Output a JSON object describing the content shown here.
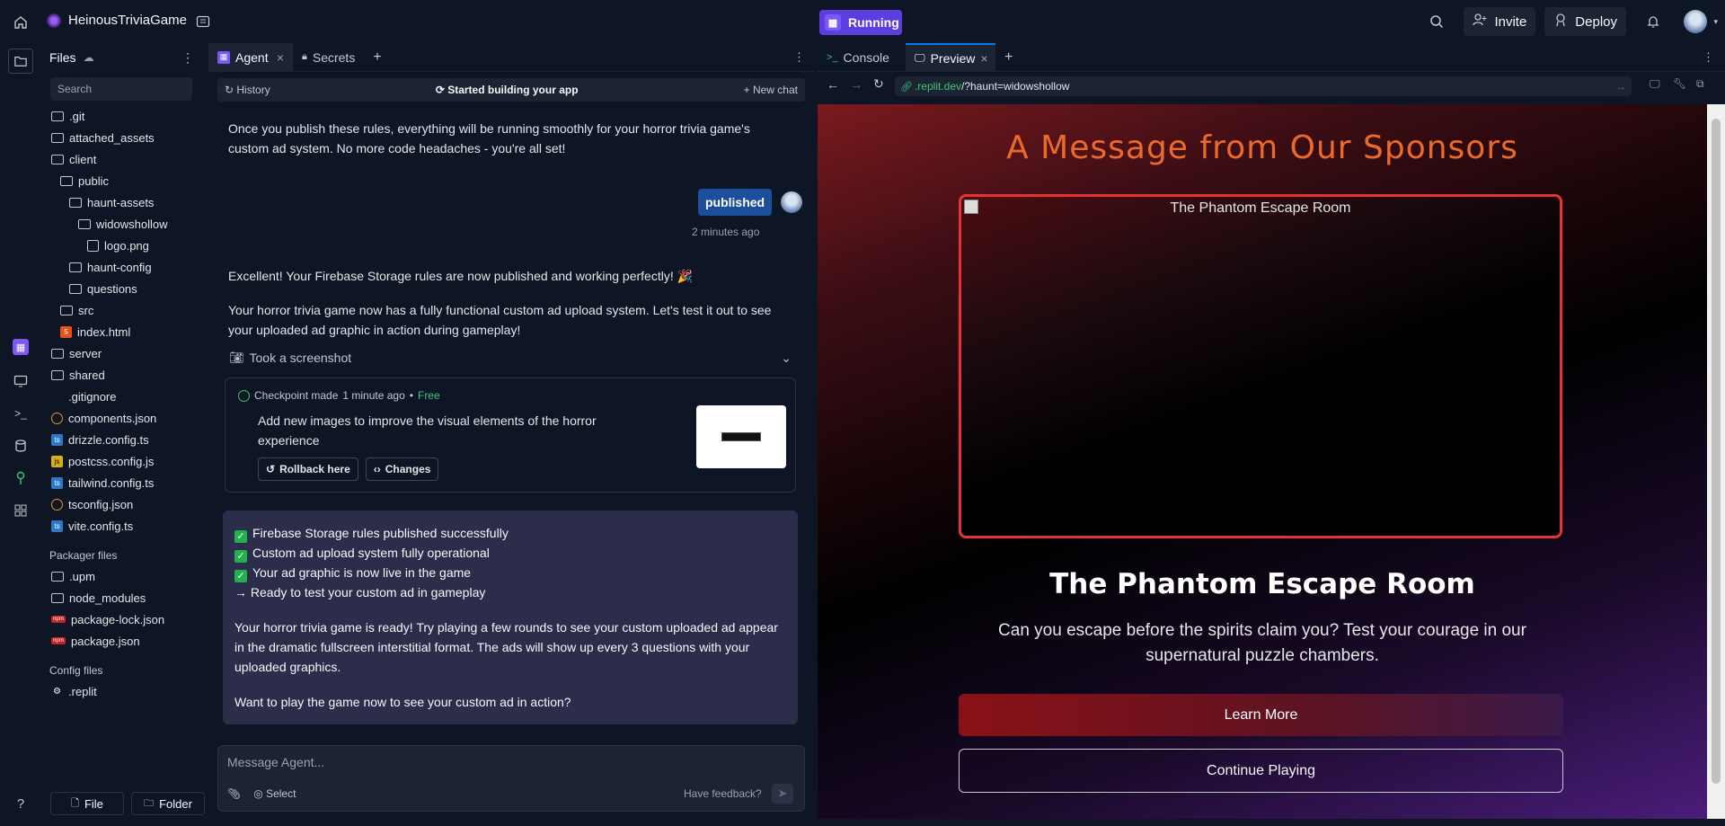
{
  "topbar": {
    "repl_name": "HeinousTriviaGame",
    "run_label": "Running",
    "invite_label": "Invite",
    "deploy_label": "Deploy"
  },
  "files": {
    "title": "Files",
    "search_placeholder": "Search",
    "tree": [
      {
        "name": ".git",
        "type": "folder",
        "depth": 0
      },
      {
        "name": "attached_assets",
        "type": "folder",
        "depth": 0
      },
      {
        "name": "client",
        "type": "folder",
        "depth": 0
      },
      {
        "name": "public",
        "type": "folder",
        "depth": 1
      },
      {
        "name": "haunt-assets",
        "type": "folder",
        "depth": 2
      },
      {
        "name": "widowshollow",
        "type": "folder",
        "depth": 3
      },
      {
        "name": "logo.png",
        "type": "image",
        "depth": 4
      },
      {
        "name": "haunt-config",
        "type": "folder",
        "depth": 2
      },
      {
        "name": "questions",
        "type": "folder",
        "depth": 2
      },
      {
        "name": "src",
        "type": "folder",
        "depth": 1
      },
      {
        "name": "index.html",
        "type": "html",
        "depth": 1
      },
      {
        "name": "server",
        "type": "folder",
        "depth": 0
      },
      {
        "name": "shared",
        "type": "folder",
        "depth": 0
      },
      {
        "name": ".gitignore",
        "type": "plain",
        "depth": 0
      },
      {
        "name": "components.json",
        "type": "json",
        "depth": 0
      },
      {
        "name": "drizzle.config.ts",
        "type": "ts",
        "depth": 0
      },
      {
        "name": "postcss.config.js",
        "type": "js",
        "depth": 0
      },
      {
        "name": "tailwind.config.ts",
        "type": "ts",
        "depth": 0
      },
      {
        "name": "tsconfig.json",
        "type": "json",
        "depth": 0
      },
      {
        "name": "vite.config.ts",
        "type": "ts",
        "depth": 0
      }
    ],
    "packager_label": "Packager files",
    "packager": [
      {
        "name": ".upm",
        "type": "folder"
      },
      {
        "name": "node_modules",
        "type": "folder"
      },
      {
        "name": "package-lock.json",
        "type": "npm"
      },
      {
        "name": "package.json",
        "type": "npm"
      }
    ],
    "config_label": "Config files",
    "config": [
      {
        "name": ".replit",
        "type": "replit"
      }
    ],
    "new_file_label": "File",
    "new_folder_label": "Folder"
  },
  "agent": {
    "tab_agent": "Agent",
    "tab_secrets": "Secrets",
    "history_label": "History",
    "status_label": "Started building your app",
    "new_chat_label": "New chat",
    "msg1": "Once you publish these rules, everything will be running smoothly for your horror trivia game's custom ad system. No more code headaches - you're all set!",
    "user_msg": "published",
    "user_time": "2 minutes ago",
    "msg2": "Excellent! Your Firebase Storage rules are now published and working perfectly! 🎉",
    "msg3": "Your horror trivia game now has a fully functional custom ad upload system. Let's test it out to see your uploaded ad graphic in action during gameplay!",
    "screenshot_label": "Took a screenshot",
    "checkpoint": {
      "title": "Checkpoint made",
      "time": "1 minute ago",
      "price": "Free",
      "desc": "Add new images to improve the visual elements of the horror experience",
      "rollback_label": "Rollback here",
      "changes_label": "Changes"
    },
    "summary": {
      "checks": [
        "Firebase Storage rules published successfully",
        "Custom ad upload system fully operational",
        "Your ad graphic is now live in the game"
      ],
      "arrow_line": "→ Ready to test your custom ad in gameplay",
      "para1": "Your horror trivia game is ready! Try playing a few rounds to see your custom uploaded ad appear in the dramatic fullscreen interstitial format. The ads will show up every 3 questions with your uploaded graphics.",
      "para2": "Want to play the game now to see your custom ad in action?"
    },
    "input_placeholder": "Message Agent...",
    "select_label": "Select",
    "feedback_label": "Have feedback?"
  },
  "preview": {
    "tab_console": "Console",
    "tab_preview": "Preview",
    "url_domain": ".replit.dev",
    "url_path": "/?haunt=widowshollow",
    "heading": "A Message from Our Sponsors",
    "ad_alt": "The Phantom Escape Room",
    "ad_title": "The Phantom Escape Room",
    "ad_desc": "Can you escape before the spirits claim you? Test your courage in our supernatural puzzle chambers.",
    "learn_more": "Learn More",
    "continue": "Continue Playing"
  },
  "colors": {
    "accent": "#5c3de0",
    "heading_orange": "#ea6a2a",
    "ad_border": "#e53333",
    "published_bubble": "#1b4f9c"
  }
}
